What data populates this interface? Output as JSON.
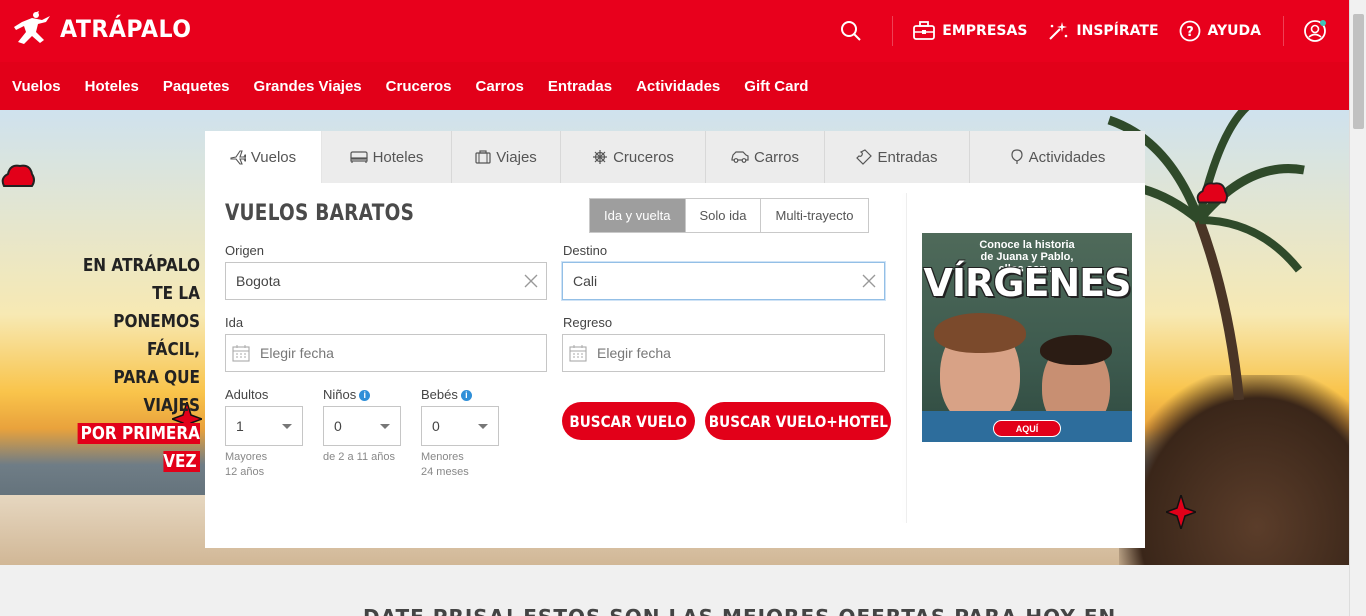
{
  "brand": {
    "name": "ATRÁPALO",
    "accent": "#e8001c"
  },
  "top_actions": [
    {
      "label": "",
      "icon": "search-icon"
    },
    {
      "label": "EMPRESAS",
      "icon": "briefcase-icon"
    },
    {
      "label": "INSPÍRATE",
      "icon": "sparkle-icon"
    },
    {
      "label": "AYUDA",
      "icon": "help-icon"
    },
    {
      "label": "",
      "icon": "user-icon"
    }
  ],
  "nav": [
    "Vuelos",
    "Hoteles",
    "Paquetes",
    "Grandes Viajes",
    "Cruceros",
    "Carros",
    "Entradas",
    "Actividades",
    "Gift Card"
  ],
  "promo": {
    "lines": [
      "EN ATRÁPALO",
      "TE LA PONEMOS",
      "FÁCIL,",
      "PARA QUE VIAJES"
    ],
    "highlight": "POR PRIMERA VEZ"
  },
  "tabs": [
    {
      "label": "Vuelos",
      "icon": "plane-icon",
      "active": true
    },
    {
      "label": "Hoteles",
      "icon": "bed-icon"
    },
    {
      "label": "Viajes",
      "icon": "suitcase-icon"
    },
    {
      "label": "Cruceros",
      "icon": "ship-wheel-icon"
    },
    {
      "label": "Carros",
      "icon": "car-icon"
    },
    {
      "label": "Entradas",
      "icon": "ticket-icon"
    },
    {
      "label": "Actividades",
      "icon": "balloon-icon"
    }
  ],
  "form": {
    "title": "VUELOS BARATOS",
    "trip_types": [
      "Ida y vuelta",
      "Solo ida",
      "Multi-trayecto"
    ],
    "origin": {
      "label": "Origen",
      "value": "Bogota"
    },
    "destination": {
      "label": "Destino",
      "value": "Cali"
    },
    "depart": {
      "label": "Ida",
      "placeholder": "Elegir fecha"
    },
    "return": {
      "label": "Regreso",
      "placeholder": "Elegir fecha"
    },
    "adults": {
      "label": "Adultos",
      "value": "1",
      "note1": "Mayores",
      "note2": "12 años"
    },
    "children": {
      "label": "Niños",
      "value": "0",
      "note1": "de 2 a 11 años"
    },
    "babies": {
      "label": "Bebés",
      "value": "0",
      "note1": "Menores",
      "note2": "24 meses"
    },
    "search_flight": "BUSCAR VUELO",
    "search_flight_hotel": "BUSCAR VUELO+HOTEL"
  },
  "ad": {
    "tagline1": "Conoce la historia",
    "tagline2": "de Juana y Pablo,",
    "tagline3": "ellos son...",
    "title": "VÍRGENES",
    "cta": "AQUÍ"
  },
  "below": {
    "title": "DATE PRISA! ESTOS SON LAS MEJORES OFERTAS PARA HOY EN"
  }
}
